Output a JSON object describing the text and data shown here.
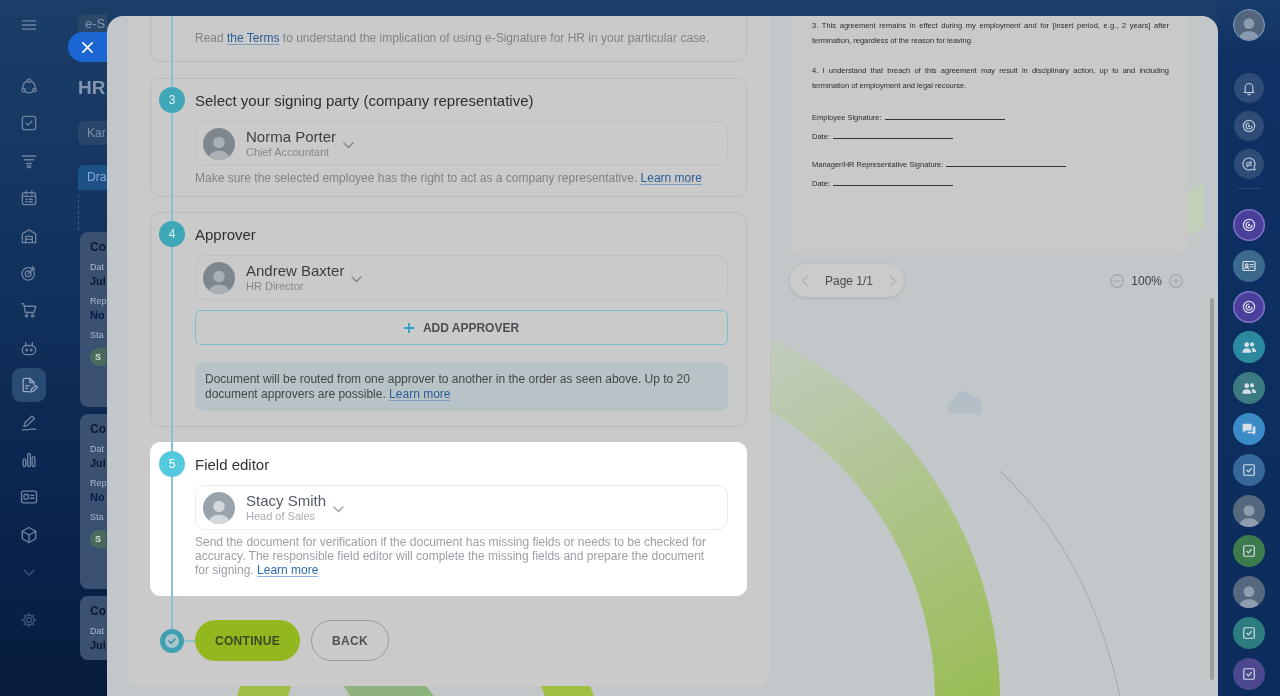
{
  "app_sidebar": {
    "items": [
      {
        "kind": "menu",
        "selected": false
      },
      {
        "kind": "flow",
        "selected": false
      },
      {
        "kind": "tasks",
        "selected": false
      },
      {
        "kind": "funnel",
        "selected": false
      },
      {
        "kind": "calendar",
        "selected": false
      },
      {
        "kind": "warehouse",
        "selected": false
      },
      {
        "kind": "target",
        "selected": false
      },
      {
        "kind": "cart",
        "selected": false
      },
      {
        "kind": "robot",
        "selected": false
      },
      {
        "kind": "document",
        "selected": true
      },
      {
        "kind": "signature",
        "selected": false
      },
      {
        "kind": "chart",
        "selected": false
      },
      {
        "kind": "card",
        "selected": false
      },
      {
        "kind": "box",
        "selected": false
      },
      {
        "kind": "more",
        "selected": false
      },
      {
        "kind": "settings",
        "selected": false
      }
    ]
  },
  "background_page": {
    "tab": "e-S",
    "title": "HR",
    "filter": "Kar",
    "column": "Dra",
    "cards": [
      {
        "title": "Co",
        "fields": [
          {
            "kind": "text",
            "label": "Dat",
            "value": "Jul"
          },
          {
            "kind": "link",
            "label": "Rep",
            "value": "No"
          },
          {
            "kind": "badge",
            "label": "Sta",
            "value": "S"
          }
        ]
      },
      {
        "title": "Co",
        "fields": [
          {
            "kind": "text",
            "label": "Dat",
            "value": "Jul"
          },
          {
            "kind": "link",
            "label": "Rep",
            "value": "No"
          },
          {
            "kind": "badge",
            "label": "Sta",
            "value": "S"
          }
        ]
      },
      {
        "title": "Co",
        "fields": [
          {
            "kind": "text",
            "label": "Dat",
            "value": "Jul"
          }
        ]
      }
    ]
  },
  "wizard": {
    "steps": [
      {
        "highlighted": false,
        "hint": {
          "before": "Read",
          "link": "the Terms",
          "after": "to understand the implication of using e-Signature for HR in your particular case."
        }
      },
      {
        "number": "3",
        "title": "Select your signing party (company representative)",
        "highlighted": false,
        "person": {
          "name": "Norma Porter",
          "role": "Chief Accountant"
        },
        "hint": {
          "before": "Make sure the selected employee has the right to act as a company representative.",
          "link": "Learn more"
        }
      },
      {
        "number": "4",
        "title": "Approver",
        "highlighted": false,
        "person": {
          "name": "Andrew Baxter",
          "role": "HR Director"
        },
        "add_button": "ADD APPROVER",
        "info": {
          "before": "Document will be routed from one approver to another in the order as seen above. Up to 20 document approvers are possible.",
          "link": "Learn more"
        }
      },
      {
        "number": "5",
        "title": "Field editor",
        "highlighted": true,
        "person": {
          "name": "Stacy Smith",
          "role": "Head of Sales"
        },
        "hint": {
          "before": "Send the document for verification if the document has missing fields or needs to be checked for accuracy. The responsible field editor will complete the missing fields and prepare the document for signing.",
          "link": "Learn more"
        }
      }
    ],
    "actions": [
      {
        "kind": "primary",
        "label": "CONTINUE"
      },
      {
        "kind": "secondary",
        "label": "BACK"
      }
    ]
  },
  "document_preview": {
    "paragraphs": [
      "3. This agreement remains in effect during my employment and for [insert period, e.g., 2 years] after termination, regardless of the reason for leaving.",
      "4. I understand that breach of this agreement may result in disciplinary action, up to and including termination of employment and legal recourse."
    ],
    "signature_blocks": [
      [
        "Employee Signature:",
        "Date:"
      ],
      [
        "Manager/HR Representative Signature:",
        "Date:"
      ]
    ],
    "pager": {
      "label": "Page 1/1",
      "prev_disabled": true,
      "next_disabled": true
    },
    "zoom": "100%"
  },
  "right_sidebar": {
    "items": [
      {
        "kind": "spiral",
        "color": "#4b3f9c"
      },
      {
        "kind": "contact",
        "color": "#3b6a8c"
      },
      {
        "kind": "spiral",
        "color": "#4b3f9c"
      },
      {
        "kind": "group",
        "color": "#2b8a9e"
      },
      {
        "kind": "group",
        "color": "#3c7b82"
      },
      {
        "kind": "chat",
        "color": "#3b8cc6"
      },
      {
        "kind": "task",
        "color": "#37689a"
      },
      {
        "kind": "photo"
      },
      {
        "kind": "task",
        "color": "#3b7b4e"
      },
      {
        "kind": "photo"
      },
      {
        "kind": "task",
        "color": "#2c7c80"
      },
      {
        "kind": "task",
        "color": "#4b4890"
      }
    ]
  }
}
